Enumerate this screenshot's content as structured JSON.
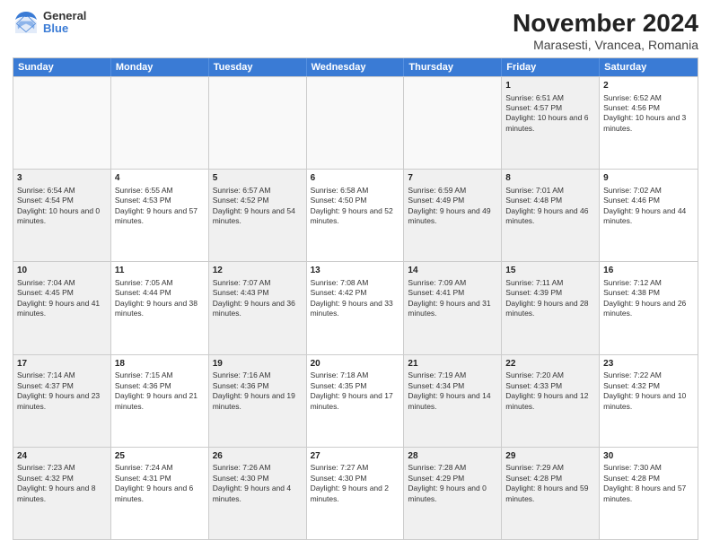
{
  "logo": {
    "general": "General",
    "blue": "Blue"
  },
  "title": "November 2024",
  "subtitle": "Marasesti, Vrancea, Romania",
  "days": [
    "Sunday",
    "Monday",
    "Tuesday",
    "Wednesday",
    "Thursday",
    "Friday",
    "Saturday"
  ],
  "rows": [
    [
      {
        "day": "",
        "info": "",
        "empty": true
      },
      {
        "day": "",
        "info": "",
        "empty": true
      },
      {
        "day": "",
        "info": "",
        "empty": true
      },
      {
        "day": "",
        "info": "",
        "empty": true
      },
      {
        "day": "",
        "info": "",
        "empty": true
      },
      {
        "day": "1",
        "info": "Sunrise: 6:51 AM\nSunset: 4:57 PM\nDaylight: 10 hours and 6 minutes.",
        "shaded": true
      },
      {
        "day": "2",
        "info": "Sunrise: 6:52 AM\nSunset: 4:56 PM\nDaylight: 10 hours and 3 minutes."
      }
    ],
    [
      {
        "day": "3",
        "info": "Sunrise: 6:54 AM\nSunset: 4:54 PM\nDaylight: 10 hours and 0 minutes.",
        "shaded": true
      },
      {
        "day": "4",
        "info": "Sunrise: 6:55 AM\nSunset: 4:53 PM\nDaylight: 9 hours and 57 minutes."
      },
      {
        "day": "5",
        "info": "Sunrise: 6:57 AM\nSunset: 4:52 PM\nDaylight: 9 hours and 54 minutes.",
        "shaded": true
      },
      {
        "day": "6",
        "info": "Sunrise: 6:58 AM\nSunset: 4:50 PM\nDaylight: 9 hours and 52 minutes."
      },
      {
        "day": "7",
        "info": "Sunrise: 6:59 AM\nSunset: 4:49 PM\nDaylight: 9 hours and 49 minutes.",
        "shaded": true
      },
      {
        "day": "8",
        "info": "Sunrise: 7:01 AM\nSunset: 4:48 PM\nDaylight: 9 hours and 46 minutes.",
        "shaded": true
      },
      {
        "day": "9",
        "info": "Sunrise: 7:02 AM\nSunset: 4:46 PM\nDaylight: 9 hours and 44 minutes."
      }
    ],
    [
      {
        "day": "10",
        "info": "Sunrise: 7:04 AM\nSunset: 4:45 PM\nDaylight: 9 hours and 41 minutes.",
        "shaded": true
      },
      {
        "day": "11",
        "info": "Sunrise: 7:05 AM\nSunset: 4:44 PM\nDaylight: 9 hours and 38 minutes."
      },
      {
        "day": "12",
        "info": "Sunrise: 7:07 AM\nSunset: 4:43 PM\nDaylight: 9 hours and 36 minutes.",
        "shaded": true
      },
      {
        "day": "13",
        "info": "Sunrise: 7:08 AM\nSunset: 4:42 PM\nDaylight: 9 hours and 33 minutes."
      },
      {
        "day": "14",
        "info": "Sunrise: 7:09 AM\nSunset: 4:41 PM\nDaylight: 9 hours and 31 minutes.",
        "shaded": true
      },
      {
        "day": "15",
        "info": "Sunrise: 7:11 AM\nSunset: 4:39 PM\nDaylight: 9 hours and 28 minutes.",
        "shaded": true
      },
      {
        "day": "16",
        "info": "Sunrise: 7:12 AM\nSunset: 4:38 PM\nDaylight: 9 hours and 26 minutes."
      }
    ],
    [
      {
        "day": "17",
        "info": "Sunrise: 7:14 AM\nSunset: 4:37 PM\nDaylight: 9 hours and 23 minutes.",
        "shaded": true
      },
      {
        "day": "18",
        "info": "Sunrise: 7:15 AM\nSunset: 4:36 PM\nDaylight: 9 hours and 21 minutes."
      },
      {
        "day": "19",
        "info": "Sunrise: 7:16 AM\nSunset: 4:36 PM\nDaylight: 9 hours and 19 minutes.",
        "shaded": true
      },
      {
        "day": "20",
        "info": "Sunrise: 7:18 AM\nSunset: 4:35 PM\nDaylight: 9 hours and 17 minutes."
      },
      {
        "day": "21",
        "info": "Sunrise: 7:19 AM\nSunset: 4:34 PM\nDaylight: 9 hours and 14 minutes.",
        "shaded": true
      },
      {
        "day": "22",
        "info": "Sunrise: 7:20 AM\nSunset: 4:33 PM\nDaylight: 9 hours and 12 minutes.",
        "shaded": true
      },
      {
        "day": "23",
        "info": "Sunrise: 7:22 AM\nSunset: 4:32 PM\nDaylight: 9 hours and 10 minutes."
      }
    ],
    [
      {
        "day": "24",
        "info": "Sunrise: 7:23 AM\nSunset: 4:32 PM\nDaylight: 9 hours and 8 minutes.",
        "shaded": true
      },
      {
        "day": "25",
        "info": "Sunrise: 7:24 AM\nSunset: 4:31 PM\nDaylight: 9 hours and 6 minutes."
      },
      {
        "day": "26",
        "info": "Sunrise: 7:26 AM\nSunset: 4:30 PM\nDaylight: 9 hours and 4 minutes.",
        "shaded": true
      },
      {
        "day": "27",
        "info": "Sunrise: 7:27 AM\nSunset: 4:30 PM\nDaylight: 9 hours and 2 minutes."
      },
      {
        "day": "28",
        "info": "Sunrise: 7:28 AM\nSunset: 4:29 PM\nDaylight: 9 hours and 0 minutes.",
        "shaded": true
      },
      {
        "day": "29",
        "info": "Sunrise: 7:29 AM\nSunset: 4:28 PM\nDaylight: 8 hours and 59 minutes.",
        "shaded": true
      },
      {
        "day": "30",
        "info": "Sunrise: 7:30 AM\nSunset: 4:28 PM\nDaylight: 8 hours and 57 minutes."
      }
    ]
  ]
}
